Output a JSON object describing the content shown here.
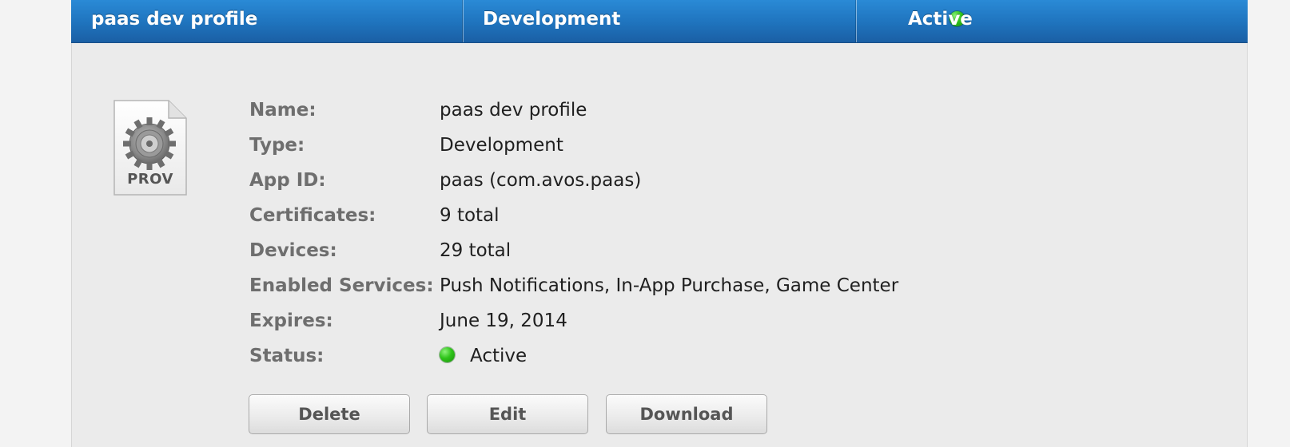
{
  "header": {
    "name": "paas dev profile",
    "type": "Development",
    "status": "Active",
    "status_color": "#2fc41a",
    "accent_color": "#1f73bd"
  },
  "icon": {
    "name": "gear-icon",
    "caption": "PROV"
  },
  "details": {
    "rows": [
      {
        "label": "Name:",
        "value": "paas dev profile"
      },
      {
        "label": "Type:",
        "value": "Development"
      },
      {
        "label": "App ID:",
        "value": "paas (com.avos.paas)"
      },
      {
        "label": "Certificates:",
        "value": "9 total"
      },
      {
        "label": "Devices:",
        "value": "29 total"
      },
      {
        "label": "Enabled Services:",
        "value": "Push Notifications, In-App Purchase, Game Center"
      },
      {
        "label": "Expires:",
        "value": "June 19, 2014"
      },
      {
        "label": "Status:",
        "value": "Active"
      }
    ]
  },
  "actions": {
    "delete_label": "Delete",
    "edit_label": "Edit",
    "download_label": "Download"
  }
}
